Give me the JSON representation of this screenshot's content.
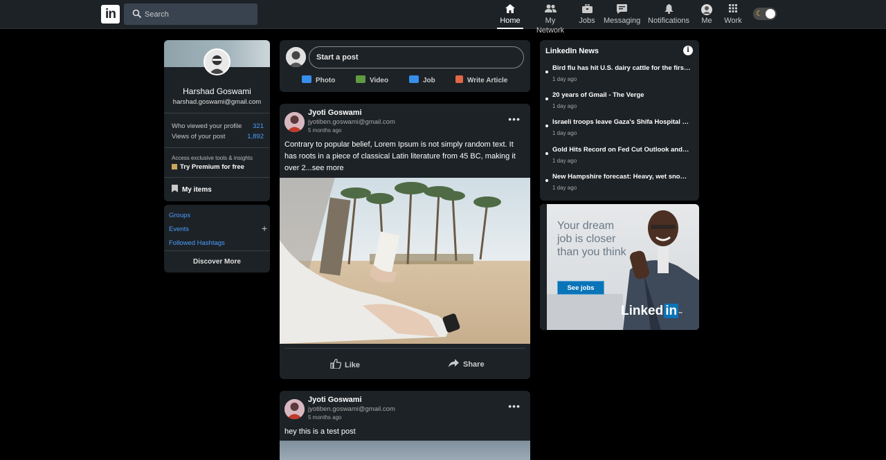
{
  "nav": {
    "logo": "in",
    "search_placeholder": "Search",
    "items": [
      {
        "label": "Home",
        "icon": "home-icon",
        "active": true
      },
      {
        "label": "My Network",
        "icon": "network-icon"
      },
      {
        "label": "Jobs",
        "icon": "briefcase-icon"
      },
      {
        "label": "Messaging",
        "icon": "message-icon"
      },
      {
        "label": "Notifications",
        "icon": "bell-icon"
      },
      {
        "label": "Me",
        "icon": "avatar"
      },
      {
        "label": "Work",
        "icon": "grid-icon"
      }
    ],
    "theme_toggle_icon": "moon-icon"
  },
  "profile": {
    "name": "Harshad Goswami",
    "email": "harshad.goswami@gmail.com",
    "stats": [
      {
        "label": "Who viewed your profile",
        "value": "321"
      },
      {
        "label": "Views of your post",
        "value": "1,892"
      }
    ],
    "premium_sub": "Access exclusive tools & insights",
    "premium_label": "Try Premium for free",
    "my_items": "My items"
  },
  "side_links": {
    "groups": "Groups",
    "events": "Events",
    "hashtags": "Followed Hashtags",
    "plus": "+",
    "discover": "Discover More"
  },
  "composer": {
    "placeholder": "Start a post",
    "actions": [
      {
        "label": "Photo",
        "color": "#378fe9"
      },
      {
        "label": "Video",
        "color": "#5f9b41"
      },
      {
        "label": "Job",
        "color": "#a872e8"
      },
      {
        "label": "Write Article",
        "color": "#e06847"
      }
    ]
  },
  "posts": [
    {
      "author": "Jyoti Goswami",
      "email": "jyotiben.goswami@gmail.com",
      "time": "5 months ago",
      "more": "•••",
      "text": "Contrary to popular belief, Lorem Ipsum is not simply random text. It has roots in a piece of classical Latin literature from 45 BC, making it over 2...see more",
      "like": "Like",
      "share": "Share"
    },
    {
      "author": "Jyoti Goswami",
      "email": "jyotiben.goswami@gmail.com",
      "time": "5 months ago",
      "more": "•••",
      "text": "hey this is a test post"
    }
  ],
  "news": {
    "title": "LinkedIn News",
    "info": "i",
    "items": [
      {
        "headline": "Bird flu has hit U.S. dairy cattle for the first time",
        "time": "1 day ago"
      },
      {
        "headline": "20 years of Gmail - The Verge",
        "time": "1 day ago"
      },
      {
        "headline": "Israeli troops leave Gaza's Shifa Hospital after",
        "time": "1 day ago"
      },
      {
        "headline": "Gold Hits Record on Fed Cut Outlook and Geopolitics",
        "time": "1 day ago"
      },
      {
        "headline": "New Hampshire forecast: Heavy, wet snow to",
        "time": "1 day ago"
      }
    ]
  },
  "ad": {
    "text": "Your dream job is closer than you think",
    "button": "See jobs",
    "logo_text": "Linked",
    "logo_in": "in",
    "logo_tm": "™"
  }
}
